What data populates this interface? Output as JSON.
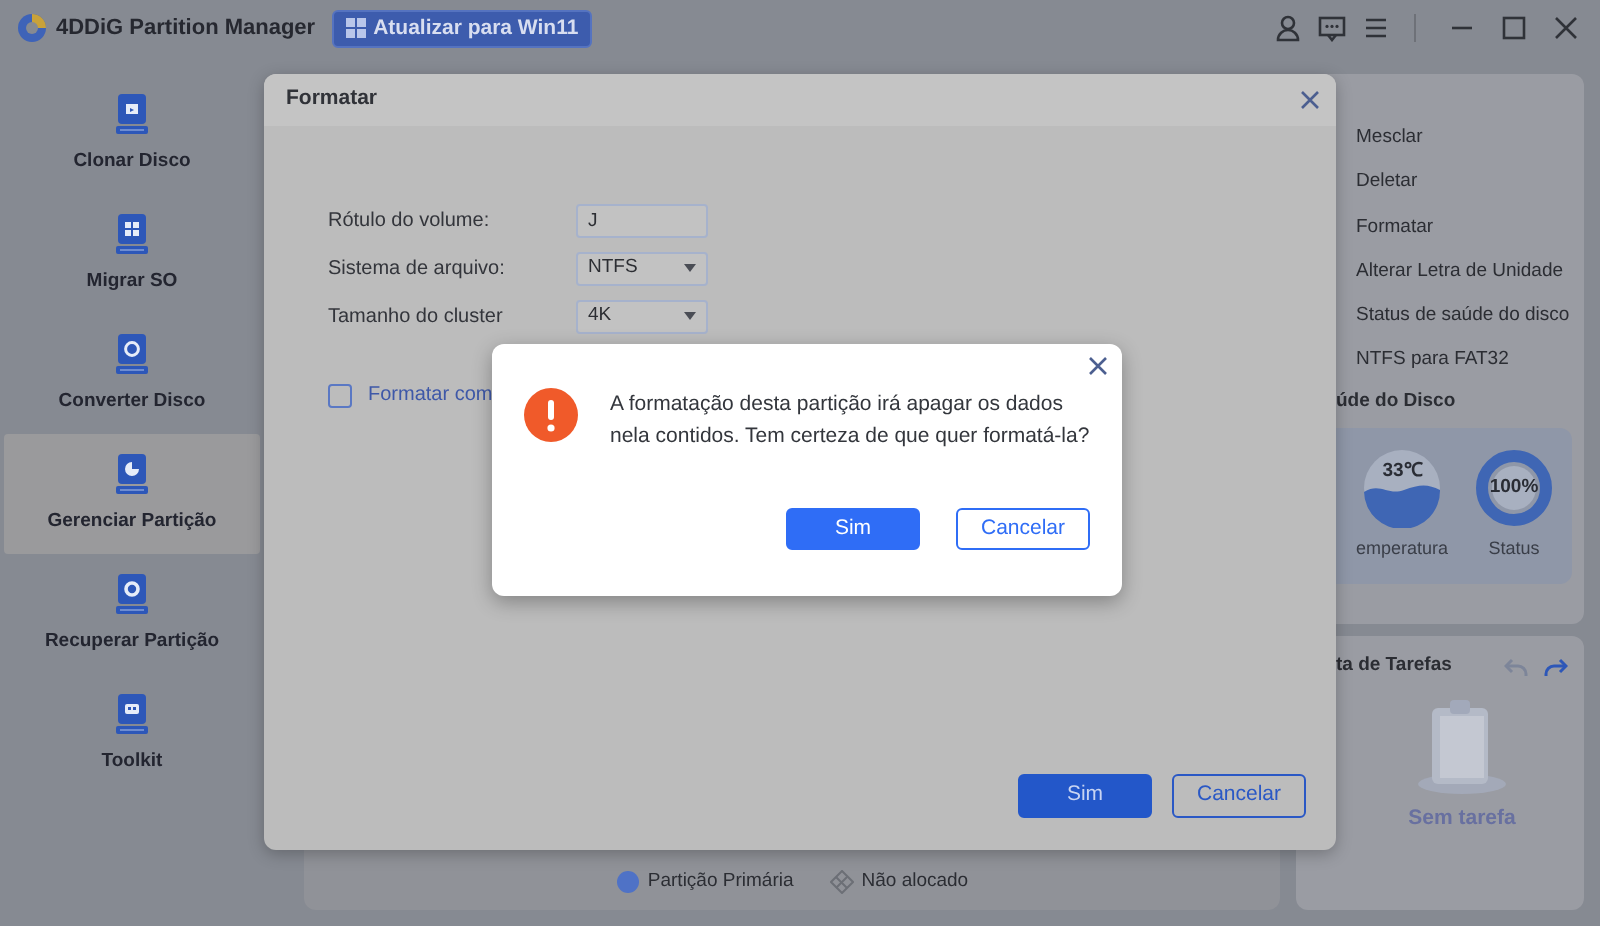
{
  "app": {
    "title": "4DDiG Partition Manager",
    "upgrade_button": "Atualizar para Win11"
  },
  "sidebar": {
    "items": [
      {
        "label": "Clonar Disco",
        "kind": "clone",
        "selected": false
      },
      {
        "label": "Migrar SO",
        "kind": "migrate",
        "selected": false
      },
      {
        "label": "Converter Disco",
        "kind": "convert",
        "selected": false
      },
      {
        "label": "Gerenciar Partição",
        "kind": "manage",
        "selected": true
      },
      {
        "label": "Recuperar Partição",
        "kind": "recover",
        "selected": false
      },
      {
        "label": "Toolkit",
        "kind": "toolkit",
        "selected": false
      }
    ]
  },
  "legend": [
    {
      "label": "Partição Primária",
      "kind": "primary"
    },
    {
      "label": "Não alocado",
      "kind": "unallocated"
    }
  ],
  "operations": [
    "Mesclar",
    "Deletar",
    "Formatar",
    "Alterar Letra de Unidade",
    "Status de saúde do disco",
    "NTFS para FAT32"
  ],
  "disk_health": {
    "title": "úde do Disco",
    "gauges": [
      {
        "kind": "temperature",
        "value": "33℃",
        "label": "emperatura"
      },
      {
        "kind": "status",
        "value": "100%",
        "label": "Status"
      }
    ]
  },
  "task_list": {
    "title": "ta de Tarefas",
    "empty_text": "Sem tarefa"
  },
  "format_dialog": {
    "title": "Formatar",
    "fields": [
      {
        "label": "Rótulo do volume:",
        "kind": "text",
        "value": "J"
      },
      {
        "label": "Sistema de arquivo:",
        "kind": "select",
        "value": "NTFS"
      },
      {
        "label": "Tamanho do cluster",
        "kind": "select",
        "value": "4K"
      }
    ],
    "quick_format": {
      "label": "Formatar com",
      "checked": false
    },
    "buttons": [
      {
        "label": "Sim",
        "kind": "primary"
      },
      {
        "label": "Cancelar",
        "kind": "secondary"
      }
    ]
  },
  "confirm_dialog": {
    "message": "A formatação desta partição irá apagar os dados nela contidos. Tem certeza de que quer formatá-la?",
    "buttons": [
      {
        "label": "Sim",
        "kind": "primary"
      },
      {
        "label": "Cancelar",
        "kind": "secondary"
      }
    ]
  }
}
